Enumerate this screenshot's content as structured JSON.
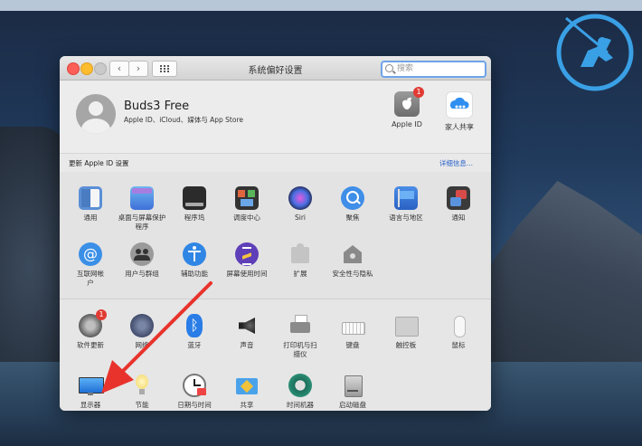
{
  "window": {
    "title": "系统偏好设置",
    "search_placeholder": "搜索"
  },
  "account": {
    "name": "Buds3 Free",
    "subtitle": "Apple ID、iCloud、媒体与 App Store",
    "apple_id_label": "Apple ID",
    "apple_id_badge": "1",
    "family_label": "家人共享"
  },
  "update_bar": {
    "label": "更新 Apple ID 设置",
    "link": "详细信息..."
  },
  "section1": [
    {
      "label": "通用",
      "icon": "general-icon"
    },
    {
      "label": "桌面与屏幕保护程序",
      "icon": "desktop-icon"
    },
    {
      "label": "程序坞",
      "icon": "dock-icon"
    },
    {
      "label": "调度中心",
      "icon": "mission-control-icon"
    },
    {
      "label": "Siri",
      "icon": "siri-icon"
    },
    {
      "label": "聚焦",
      "icon": "spotlight-icon"
    },
    {
      "label": "语言与地区",
      "icon": "language-icon"
    },
    {
      "label": "通知",
      "icon": "notifications-icon"
    },
    {
      "label": "互联网帐户",
      "icon": "internet-accounts-icon"
    },
    {
      "label": "用户与群组",
      "icon": "users-icon"
    },
    {
      "label": "辅助功能",
      "icon": "accessibility-icon"
    },
    {
      "label": "屏幕使用时间",
      "icon": "screen-time-icon"
    },
    {
      "label": "扩展",
      "icon": "extensions-icon"
    },
    {
      "label": "安全性与隐私",
      "icon": "security-icon"
    }
  ],
  "section2": [
    {
      "label": "软件更新",
      "icon": "software-update-icon",
      "badge": "1"
    },
    {
      "label": "网络",
      "icon": "network-icon"
    },
    {
      "label": "蓝牙",
      "icon": "bluetooth-icon"
    },
    {
      "label": "声音",
      "icon": "sound-icon"
    },
    {
      "label": "打印机与扫描仪",
      "icon": "printer-icon"
    },
    {
      "label": "键盘",
      "icon": "keyboard-icon"
    },
    {
      "label": "触控板",
      "icon": "trackpad-icon"
    },
    {
      "label": "鼠标",
      "icon": "mouse-icon"
    },
    {
      "label": "显示器",
      "icon": "display-icon"
    },
    {
      "label": "节能",
      "icon": "energy-icon"
    },
    {
      "label": "日期与时间",
      "icon": "date-time-icon"
    },
    {
      "label": "共享",
      "icon": "sharing-icon"
    },
    {
      "label": "时间机器",
      "icon": "time-machine-icon"
    },
    {
      "label": "启动磁盘",
      "icon": "startup-disk-icon"
    }
  ],
  "colors": {
    "accent": "#2a62c9",
    "arrow": "#e8332c",
    "badge": "#e23a34"
  }
}
